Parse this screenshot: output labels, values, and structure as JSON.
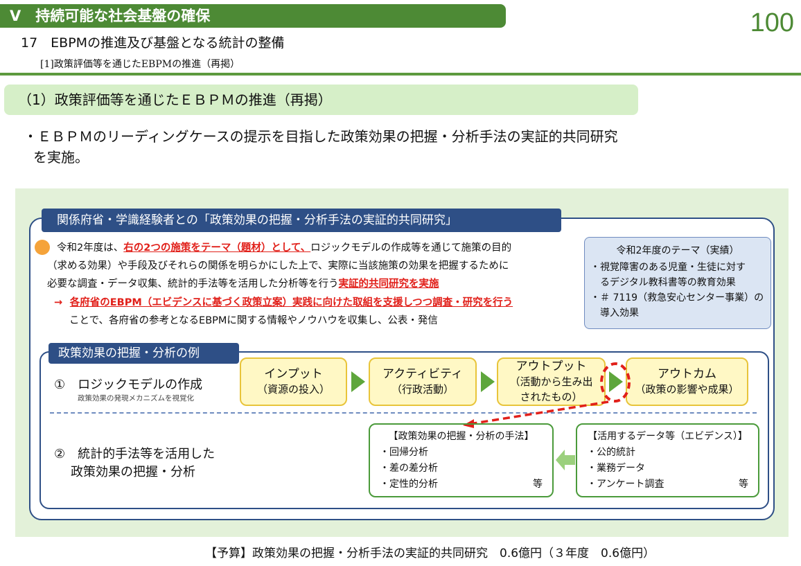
{
  "header": {
    "section_title": "Ⅴ　持続可能な社会基盤の確保",
    "subtitle": "17　EBPMの推進及び基盤となる統計の整備",
    "sub_subtitle": "[1]政策評価等を通じたEBPMの推進（再掲）",
    "page_number": "100"
  },
  "heading": "（1）政策評価等を通じたＥＢＰＭの推進（再掲）",
  "body_lines": [
    "・ＥＢＰＭのリーディングケースの提示を目指した政策効果の把握・分析手法の実証的共同研究",
    "を実施。"
  ],
  "panel": {
    "tab_title": "関係府省・学識経験者との「政策効果の把握・分析手法の実証的共同研究」",
    "para": {
      "l1_a": "令和2年度は、",
      "l1_red": "右の2つの施策をテーマ（題材）として、",
      "l1_b": "ロジックモデルの作成等を通じて施策の目的",
      "l2": "（求める効果）や手段及びそれらの関係を明らかにした上で、実際に当該施策の効果を把握するために",
      "l3_a": "必要な調査・データ収集、統計的手法等を活用した分析等を行う",
      "l3_red": "実証的共同研究を実施",
      "l4_arrow": "→",
      "l4_red": "各府省のEBPM（エビデンスに基づく政策立案）実践に向けた取組を支援しつつ調査・研究を行う",
      "l5": "ことで、各府省の参考となるEBPMに関する情報やノウハウを収集し、公表・発信"
    },
    "theme": {
      "title": "令和2年度のテーマ（実績）",
      "lines": [
        "・視覚障害のある児童・生徒に対す",
        "　るデジタル教科書等の教育効果",
        "・＃ 7119（救急安心センター事業）の",
        "　導入効果"
      ]
    },
    "examples": {
      "tab_title": "政策効果の把握・分析の例",
      "item1": "①　ロジックモデルの作成",
      "item1_sub": "政策効果の発現メカニズムを視覚化",
      "item2_l1": "②　統計的手法等を活用した",
      "item2_l2": "政策効果の把握・分析",
      "flow": [
        {
          "main": "インプット",
          "sub": "（資源の投入）"
        },
        {
          "main": "アクティビティ",
          "sub": "（行政活動）"
        },
        {
          "main": "アウトプット",
          "sub": "（活動から生み出",
          "sub2": "されたもの）"
        },
        {
          "main": "アウトカム",
          "sub": "（政策の影響や成果）"
        }
      ],
      "methods": {
        "title": "【政策効果の把握・分析の手法】",
        "items": [
          "・回帰分析",
          "・差の差分析",
          "・定性的分析"
        ],
        "etc": "等"
      },
      "data": {
        "title": "【活用するデータ等（エビデンス）】",
        "items": [
          "・公的統計",
          "・業務データ",
          "・アンケート調査"
        ],
        "etc": "等"
      }
    }
  },
  "budget": "【予算】政策効果の把握・分析手法の実証的共同研究　0.6億円（３年度　0.6億円）",
  "colors": {
    "section_green": "#4d8a35",
    "heading_bg": "#d6efc8",
    "panel_bg": "#e3f1d9",
    "navy": "#2e4f86",
    "red": "#e1201a",
    "yellow_box": "#fff8c5",
    "arrow_green": "#5ea63c"
  }
}
